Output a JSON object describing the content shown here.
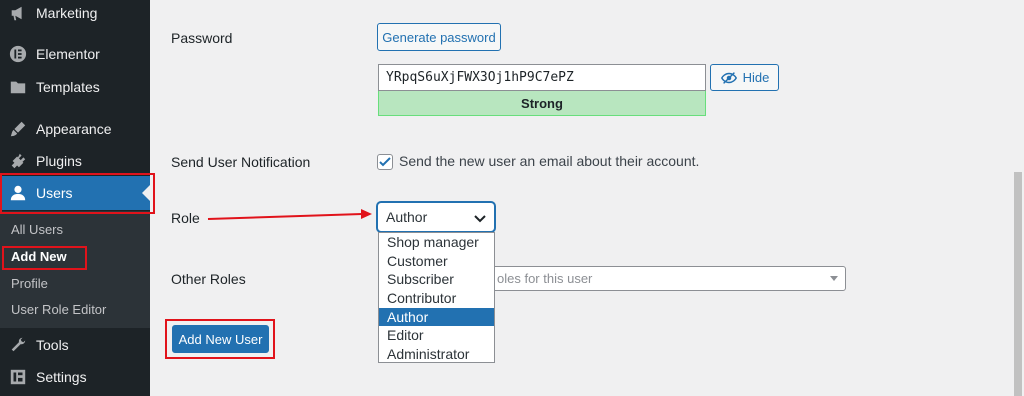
{
  "sidebar": {
    "items": [
      {
        "label": "Marketing",
        "icon": "megaphone-icon"
      },
      {
        "label": "Elementor",
        "icon": "elementor-icon"
      },
      {
        "label": "Templates",
        "icon": "folder-icon"
      },
      {
        "label": "Appearance",
        "icon": "paintbrush-icon"
      },
      {
        "label": "Plugins",
        "icon": "plugin-icon"
      },
      {
        "label": "Users",
        "icon": "user-icon"
      },
      {
        "label": "Tools",
        "icon": "wrench-icon"
      },
      {
        "label": "Settings",
        "icon": "settings-icon"
      }
    ],
    "submenu": [
      {
        "label": "All Users"
      },
      {
        "label": "Add New"
      },
      {
        "label": "Profile"
      },
      {
        "label": "User Role Editor"
      }
    ]
  },
  "form": {
    "password_label": "Password",
    "generate_label": "Generate password",
    "password_value": "YRpqS6uXjFWX3Oj1hP9C7ePZ",
    "hide_label": "Hide",
    "strength_label": "Strong",
    "notification_label": "Send User Notification",
    "notification_text": "Send the new user an email about their account.",
    "notification_checked": true,
    "role_label": "Role",
    "role_selected": "Author",
    "role_options": [
      "Shop manager",
      "Customer",
      "Subscriber",
      "Contributor",
      "Author",
      "Editor",
      "Administrator"
    ],
    "other_roles_label": "Other Roles",
    "other_roles_placeholder": "oles for this user",
    "submit_label": "Add New User"
  },
  "colors": {
    "accent": "#2271b1",
    "sidebar_bg": "#1d2327",
    "highlight_red": "#e1131b",
    "strength_green": "#b8e6bf"
  }
}
